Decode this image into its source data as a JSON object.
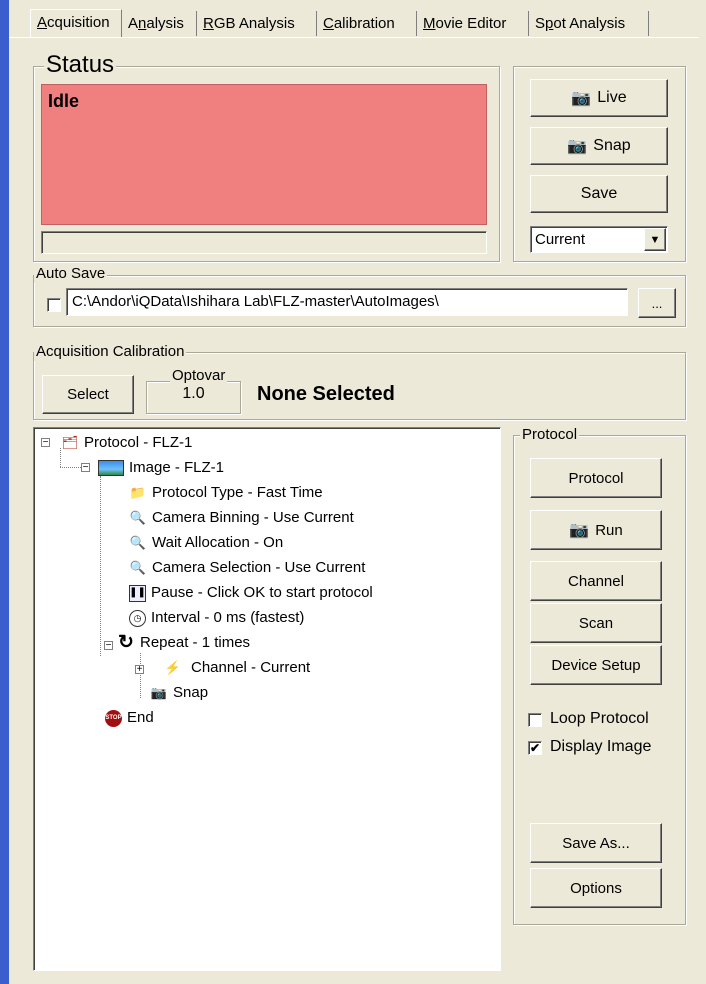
{
  "tabs": [
    {
      "pre": "",
      "u": "A",
      "post": "cquisition"
    },
    {
      "pre": "A",
      "u": "n",
      "post": "alysis"
    },
    {
      "pre": "",
      "u": "R",
      "post": "GB Analysis"
    },
    {
      "pre": "",
      "u": "C",
      "post": "alibration"
    },
    {
      "pre": "",
      "u": "M",
      "post": "ovie Editor"
    },
    {
      "pre": "S",
      "u": "p",
      "post": "ot Analysis"
    }
  ],
  "status": {
    "legend": "Status",
    "text": "Idle",
    "bg_color": "#f08080"
  },
  "buttons": {
    "live": "Live",
    "snap": "Snap",
    "save": "Save",
    "save_select": "Current"
  },
  "autosave": {
    "legend": "Auto Save",
    "path": "C:\\Andor\\iQData\\Ishihara Lab\\FLZ-master\\AutoImages\\",
    "browse": "..."
  },
  "calibration": {
    "legend": "Acquisition Calibration",
    "select": "Select",
    "optovar_label": "Optovar",
    "optovar_value": "1.0",
    "selected": "None Selected"
  },
  "tree": [
    {
      "label": "Protocol - FLZ-1",
      "icon": "protocol-icon",
      "glyph": "🗂"
    },
    {
      "label": "Image - FLZ-1",
      "icon": "image-icon",
      "glyph": "▬"
    },
    {
      "label": "Protocol Type - Fast Time",
      "icon": "folder-icon",
      "glyph": "📁"
    },
    {
      "label": "Camera Binning - Use Current",
      "icon": "magnifier-icon",
      "glyph": "🔍"
    },
    {
      "label": "Wait Allocation - On",
      "icon": "magnifier-icon",
      "glyph": "🔍"
    },
    {
      "label": "Camera Selection - Use Current",
      "icon": "magnifier-icon",
      "glyph": "🔍"
    },
    {
      "label": "Pause - Click OK to start protocol",
      "icon": "pause-icon",
      "glyph": "⏸"
    },
    {
      "label": "Interval - 0 ms (fastest)",
      "icon": "clock-icon",
      "glyph": "🕑"
    },
    {
      "label": "Repeat - 1 times",
      "icon": "repeat-icon",
      "glyph": "↻"
    },
    {
      "label": "Channel - Current",
      "icon": "lightning-icon",
      "glyph": "⚡"
    },
    {
      "label": "Snap",
      "icon": "camera-icon",
      "glyph": "📷"
    },
    {
      "label": "End",
      "icon": "stop-icon",
      "glyph": "⛔"
    }
  ],
  "protocol_panel": {
    "legend": "Protocol",
    "protocol_btn": "Protocol",
    "run_btn": "Run",
    "channel_btn": "Channel",
    "scan_btn": "Scan",
    "device_btn": "Device Setup",
    "loop_label": "Loop Protocol",
    "display_label": "Display Image",
    "save_as_btn": "Save As...",
    "options_btn": "Options",
    "check_mark": "✔"
  }
}
